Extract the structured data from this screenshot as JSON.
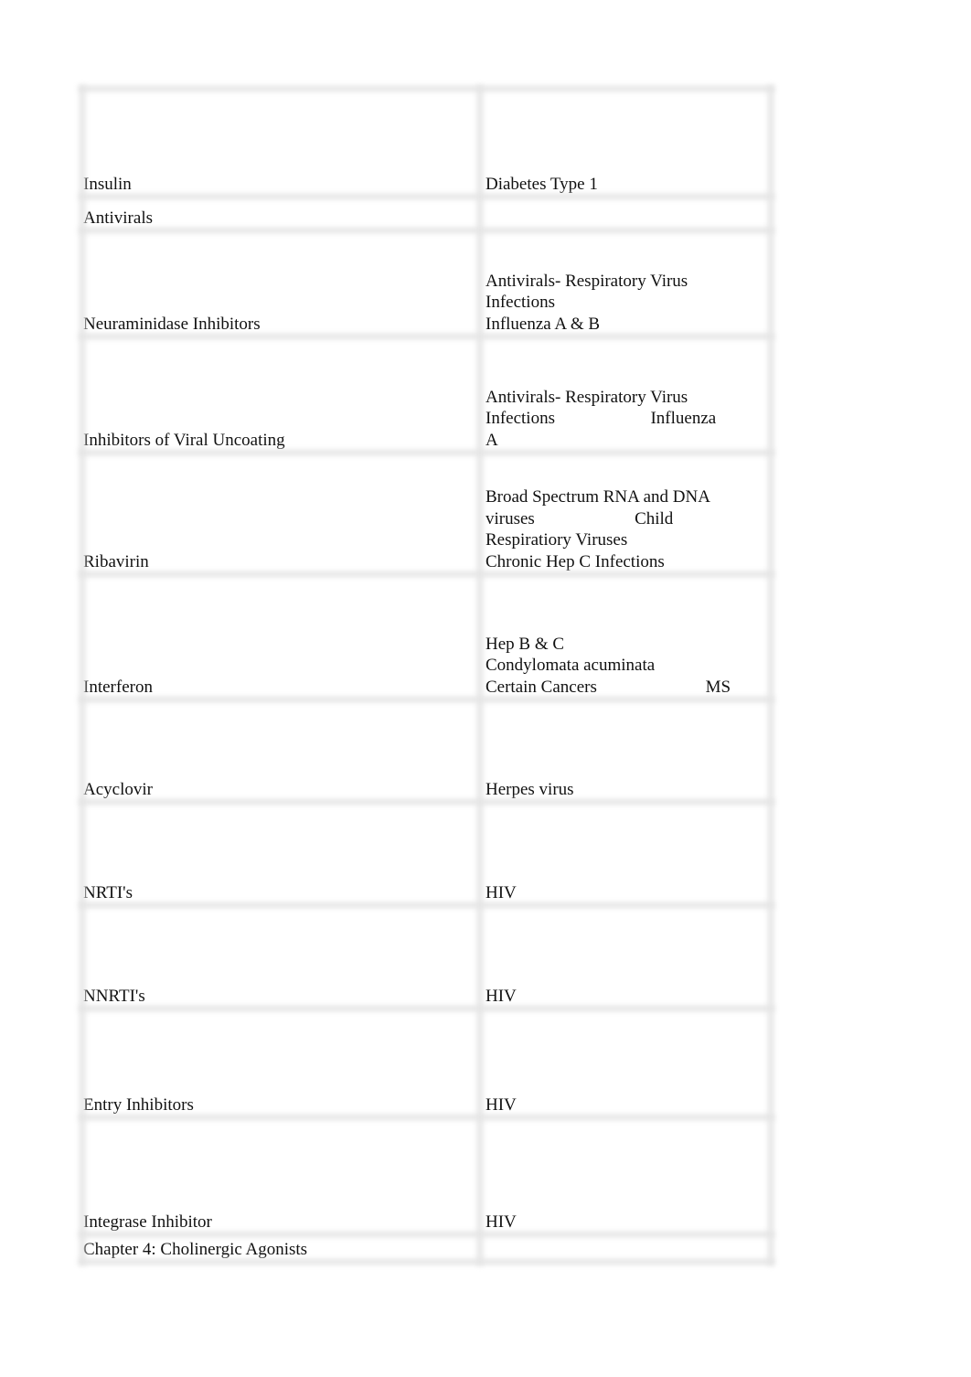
{
  "table": {
    "rows": [
      {
        "left": [
          "Insulin"
        ],
        "right": [
          "Diabetes Type 1"
        ]
      },
      {
        "left": [
          "Antivirals"
        ],
        "right": [
          ""
        ]
      },
      {
        "left": [
          "Neuraminidase Inhibitors"
        ],
        "right": [
          "Antivirals- Respiratory Virus",
          "Infections",
          "Influenza A & B"
        ]
      },
      {
        "left": [
          "Inhibitors of Viral Uncoating"
        ],
        "right": [
          "Antivirals- Respiratory Virus",
          "Infections                      Influenza",
          "A"
        ]
      },
      {
        "left": [
          "Ribavirin"
        ],
        "right": [
          "Broad Spectrum RNA and DNA",
          "viruses                       Child",
          "Respiratiory Viruses",
          "Chronic Hep C Infections"
        ]
      },
      {
        "left": [
          "Interferon"
        ],
        "right": [
          "Hep B & C",
          "Condylomata acuminata",
          "Certain Cancers                         MS"
        ]
      },
      {
        "left": [
          "Acyclovir"
        ],
        "right": [
          "Herpes virus"
        ]
      },
      {
        "left": [
          "NRTI's"
        ],
        "right": [
          "HIV"
        ]
      },
      {
        "left": [
          "NNRTI's"
        ],
        "right": [
          "HIV"
        ]
      },
      {
        "left": [
          "Entry Inhibitors"
        ],
        "right": [
          "HIV"
        ]
      },
      {
        "left": [
          "Integrase Inhibitor"
        ],
        "right": [
          "HIV"
        ]
      },
      {
        "left": [
          "Chapter 4: Cholinergic Agonists"
        ],
        "right": [
          ""
        ]
      }
    ]
  }
}
